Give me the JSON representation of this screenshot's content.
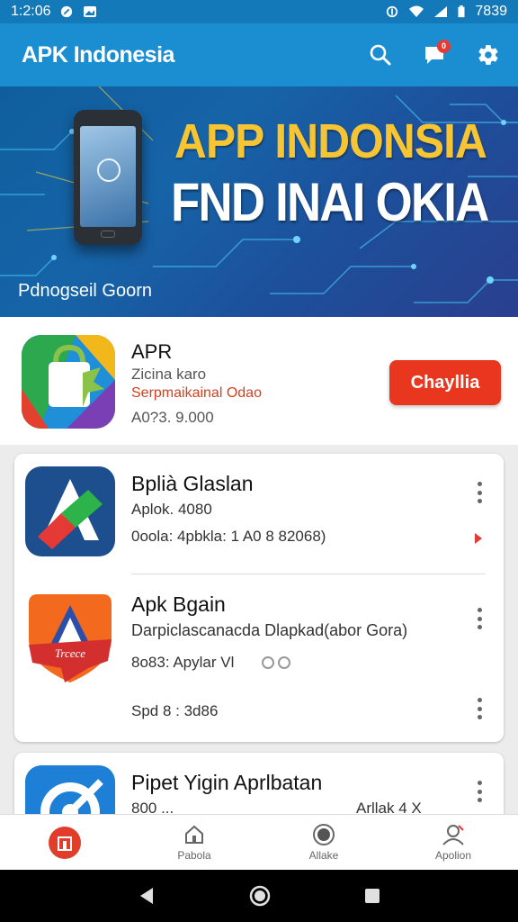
{
  "status_bar": {
    "time": "1:2:06",
    "battery": "7839"
  },
  "app_bar": {
    "title": "APK Indonesia",
    "notification_count": "0"
  },
  "banner": {
    "headline": "APP INDONSIA",
    "subheadline": "FND INAI OKIA",
    "caption": "Pdnogseil Goorn"
  },
  "featured": {
    "title": "APR",
    "line1": "Zicina karo",
    "line2": "Serpmaikainal Odao",
    "line3": "A0?3. 9.000",
    "button": "Chayllia"
  },
  "apps": [
    {
      "title": "Bplià Glaslan",
      "line1": "Aplok. 4080",
      "line2": "0oola: 4pbkla: 1 A0 8 82068)"
    },
    {
      "title": "Apk Bgain",
      "line1": "Darpiclascanacda Dlapkad(abor Gora)",
      "line2": "8o83: Apylar Vl",
      "line3": "Spd 8 : 3d86",
      "ribbon": "Trcece"
    },
    {
      "title": "Pipet Yigin Aprlbatan",
      "line1": "800 ...",
      "line2": "Arllak 4 X"
    }
  ],
  "bottom_nav": {
    "items": [
      "",
      "Pabola",
      "Allake",
      "Apolion"
    ]
  }
}
